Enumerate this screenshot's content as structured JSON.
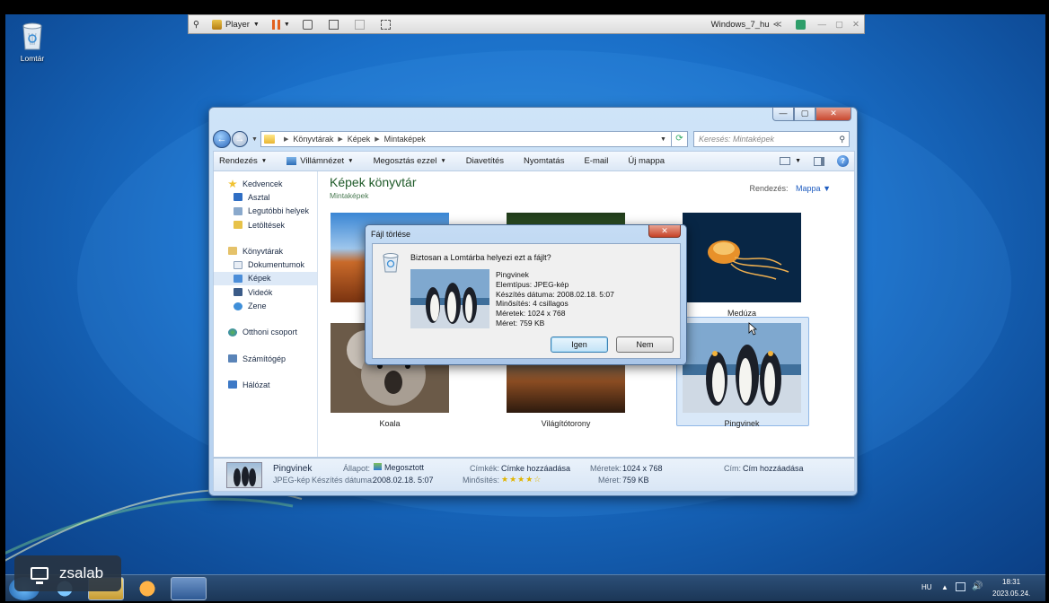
{
  "desktop": {
    "recycle_bin_label": "Lomtár"
  },
  "vmware": {
    "player_label": "Player",
    "vm_name": "Windows_7_hu",
    "vm_suffix": "≪"
  },
  "explorer": {
    "address": {
      "crumbs": [
        "Könyvtárak",
        "Képek",
        "Mintaképek"
      ],
      "search_placeholder": "Keresés: Mintaképek"
    },
    "toolbar": {
      "items": [
        "Rendezés",
        "Villámnézet",
        "Megosztás ezzel",
        "Diavetítés",
        "Nyomtatás",
        "E-mail",
        "Új mappa"
      ]
    },
    "nav": {
      "favorites": "Kedvencek",
      "desktop": "Asztal",
      "recent": "Legutóbbi helyek",
      "downloads": "Letöltések",
      "libraries": "Könyvtárak",
      "documents": "Dokumentumok",
      "pictures": "Képek",
      "videos": "Videók",
      "music": "Zene",
      "homegroup": "Otthoni csoport",
      "computer": "Számítógép",
      "network": "Hálózat"
    },
    "library_title": "Képek könyvtár",
    "library_sub": "Mintaképek",
    "arrange_label": "Rendezés:",
    "arrange_value": "Mappa",
    "thumbnails": {
      "meduza": "Medúza",
      "koala": "Koala",
      "lighthouse": "Világítótorony",
      "penguins": "Pingvinek"
    },
    "details": {
      "name": "Pingvinek",
      "type": "JPEG-kép",
      "state_label": "Állapot:",
      "state_value": "Megosztott",
      "date_label": "Készítés dátuma:",
      "date_value": "2008.02.18. 5:07",
      "tags_label": "Címkék:",
      "tags_value": "Címke hozzáadása",
      "rating_label": "Minősítés:",
      "rating_stars": 4,
      "dims_label": "Méretek:",
      "dims_value": "1024 x 768",
      "size_label": "Méret:",
      "size_value": "759 KB",
      "title_label": "Cím:",
      "title_value": "Cím hozzáadása"
    }
  },
  "dialog": {
    "title": "Fájl törlése",
    "question": "Biztosan a Lomtárba helyezi ezt a fájlt?",
    "info": [
      "Pingvinek",
      "Elemtípus: JPEG-kép",
      "Készítés dátuma: 2008.02.18. 5:07",
      "Minősítés: 4 csillagos",
      "Méretek: 1024 x 768",
      "Méret: 759 KB"
    ],
    "yes": "Igen",
    "no": "Nem"
  },
  "overlay": {
    "brand": "zsalab"
  },
  "taskbar": {
    "lang": "HU",
    "time": "18:31",
    "date": "2023.05.24."
  }
}
